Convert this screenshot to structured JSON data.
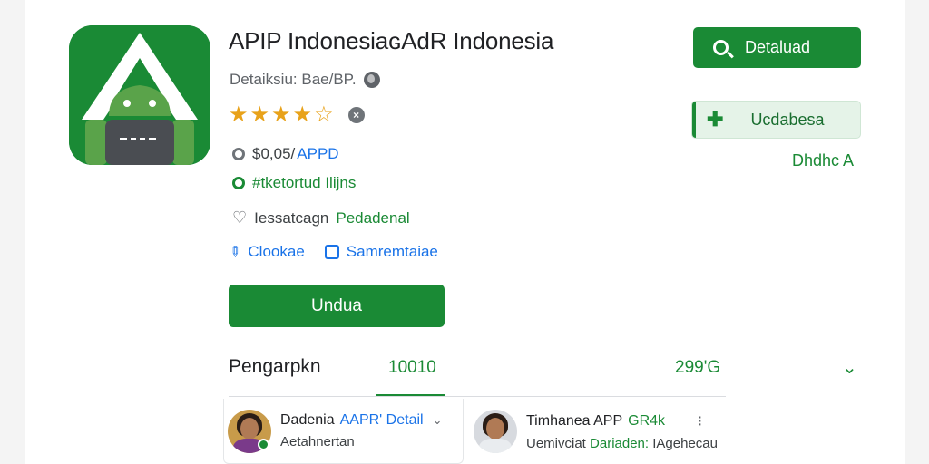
{
  "app": {
    "title": "APIP IndonesiaɢAdR Indonesia",
    "developer": "Detaiksiu: Bae/BP.",
    "rating_stars": 4,
    "rating_max": 5
  },
  "meta": {
    "price_prefix": "$0,05/",
    "price_accent": "APPD",
    "tags": "#tketortud Ilijns",
    "audience_prefix": "Iessatcagn",
    "audience_accent": "Pedadenal"
  },
  "links": {
    "edit": "Clookae",
    "comment": "Samremtaiae"
  },
  "buttons": {
    "install": "Undua",
    "search": "Detaluad",
    "update": "Ucdabesa",
    "side_label": "Dhdhc A"
  },
  "stats": {
    "title": "Pengarpkn",
    "number": "10010",
    "percent": "299'G"
  },
  "reviews": [
    {
      "name": "Dadenia",
      "badge": "AAPR' Detail",
      "sub": "Aetahnertan"
    },
    {
      "name": "Timhanea APP",
      "badge": "GR4k",
      "sub_prefix": "Uemivciat",
      "sub_accent": "Dariaden:",
      "sub_suffix": "IAgehecau"
    }
  ],
  "colors": {
    "brand_green": "#1a8a35",
    "link_blue": "#1a73e8",
    "star": "#e8a21a"
  },
  "icons": [
    "android-app-icon",
    "globe-icon",
    "star-icon",
    "info-icon",
    "price-icon",
    "tag-icon",
    "heart-icon",
    "pencil-icon",
    "comment-icon",
    "search-icon",
    "plus-icon",
    "chevron-down-icon",
    "verified-icon",
    "more-icon"
  ]
}
